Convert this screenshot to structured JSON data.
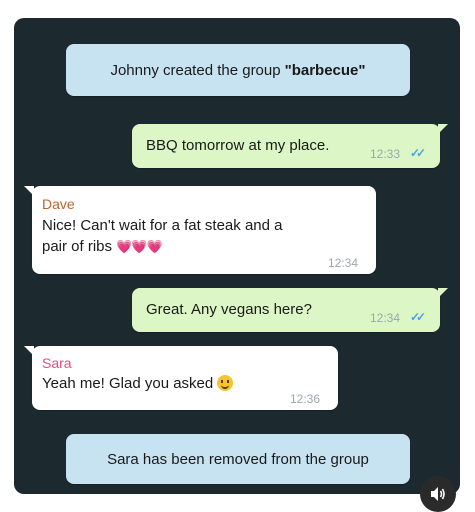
{
  "system_messages": {
    "created_prefix": "Johnny created the group",
    "group_name": "\"barbecue\"",
    "removed": "Sara has been removed from the group"
  },
  "messages": [
    {
      "text": "BBQ tomorrow at my place.",
      "time": "12:33"
    },
    {
      "sender": "Dave",
      "line1": "Nice! Can't wait for a fat steak and a",
      "line2": "pair of ribs",
      "time": "12:34"
    },
    {
      "text": "Great. Any vegans here?",
      "time": "12:34"
    },
    {
      "sender": "Sara",
      "text": "Yeah me! Glad you asked",
      "time": "12:36"
    }
  ],
  "icons": {
    "read_ticks": "✓✓",
    "hearts": "💗💗💗",
    "volume": "volume-icon"
  },
  "colors": {
    "chat_bg": "#1c2a30",
    "outgoing_bubble": "#dcf7c5",
    "incoming_bubble": "#ffffff",
    "system_bubble": "#c7e3f1",
    "dave_name": "#c0632b",
    "sara_name": "#e0507a",
    "read_ticks": "#4fa3e0"
  }
}
